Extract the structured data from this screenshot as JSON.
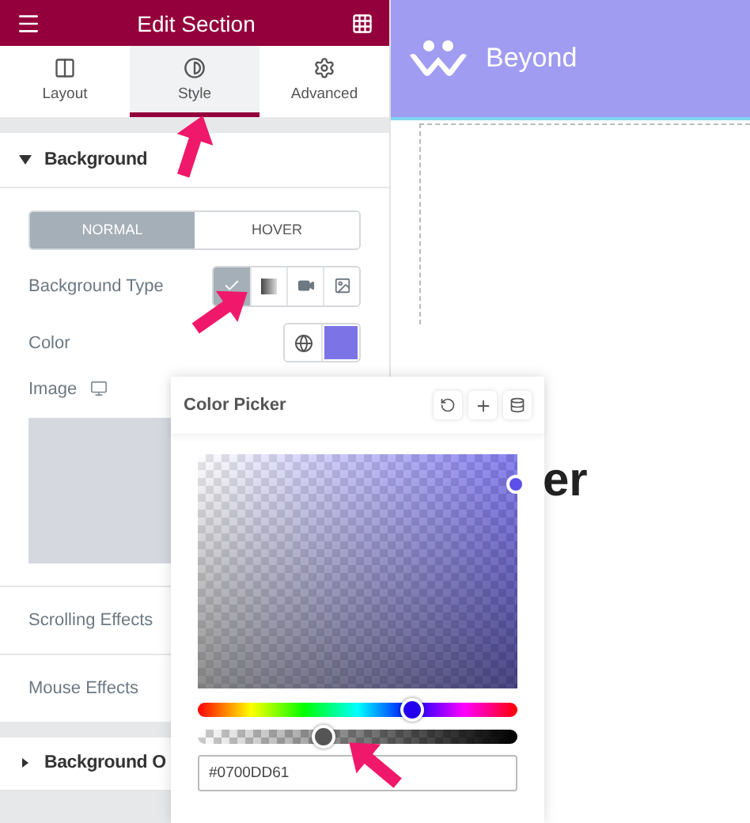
{
  "panel": {
    "title": "Edit Section",
    "tabs": [
      {
        "label": "Layout",
        "selected": false
      },
      {
        "label": "Style",
        "selected": true
      },
      {
        "label": "Advanced",
        "selected": false
      }
    ],
    "section": {
      "title": "Background",
      "expanded": true,
      "states": [
        {
          "label": "NORMAL",
          "selected": true
        },
        {
          "label": "HOVER",
          "selected": false
        }
      ],
      "background_type": {
        "label": "Background Type",
        "options": [
          {
            "kind": "classic",
            "selected": true
          },
          {
            "kind": "gradient",
            "selected": false
          },
          {
            "kind": "video",
            "selected": false
          },
          {
            "kind": "slideshow",
            "selected": false
          }
        ]
      },
      "color": {
        "label": "Color"
      },
      "image": {
        "label": "Image"
      },
      "rows": [
        "Scrolling Effects",
        "Mouse Effects"
      ]
    },
    "collapsed_section": {
      "title": "Background O",
      "expanded": false
    }
  },
  "canvas": {
    "logo_text": "Beyond",
    "heading_fragment": "er"
  },
  "color_picker": {
    "title": "Color Picker",
    "hue": {
      "level": 0.67
    },
    "alpha": {
      "level": 0.39
    },
    "hex": "#0700DD61"
  }
}
